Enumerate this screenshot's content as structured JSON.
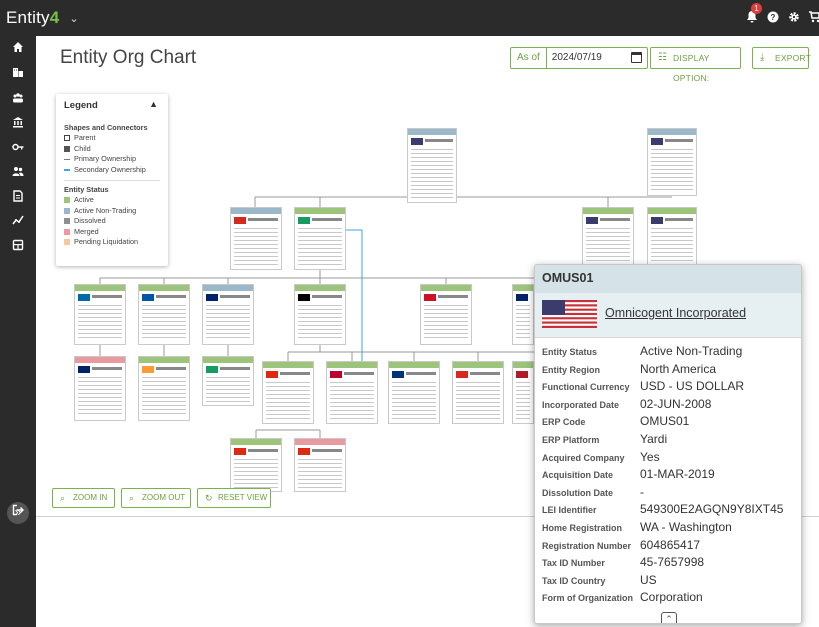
{
  "app": {
    "brand_prefix": "Entity",
    "brand_number": "4",
    "brand_caret": "⌄",
    "notification_count": "1"
  },
  "header": {
    "title": "Entity Org Chart",
    "as_of_label": "As of",
    "as_of_date": "2024/07/19",
    "display_options_label": "DISPLAY OPTION:",
    "export_label": "EXPORT"
  },
  "legend": {
    "title": "Legend",
    "shapes_heading": "Shapes and Connectors",
    "shapes": [
      "Parent",
      "Child",
      "Primary Ownership",
      "Secondary Ownership"
    ],
    "status_heading": "Entity Status",
    "statuses": [
      {
        "label": "Active",
        "color": "#9cc47a"
      },
      {
        "label": "Active Non-Trading",
        "color": "#9ab8c8"
      },
      {
        "label": "Dissolved",
        "color": "#8f8f8f"
      },
      {
        "label": "Merged",
        "color": "#e89aa0"
      },
      {
        "label": "Pending Liquidation",
        "color": "#f5c9a0"
      }
    ]
  },
  "zoom": {
    "zoom_in": "ZOOM IN",
    "zoom_out": "ZOOM OUT",
    "reset": "RESET VIEW"
  },
  "popup": {
    "code": "OMUS01",
    "name": "Omnicogent Incorporated",
    "fields": [
      {
        "key": "Entity Status",
        "value": "Active Non-Trading"
      },
      {
        "key": "Entity Region",
        "value": "North America"
      },
      {
        "key": "Functional Currency",
        "value": "USD - US DOLLAR"
      },
      {
        "key": "Incorporated Date",
        "value": "02-JUN-2008"
      },
      {
        "key": "ERP Code",
        "value": "OMUS01"
      },
      {
        "key": "ERP Platform",
        "value": "Yardi"
      },
      {
        "key": "Acquired Company",
        "value": "Yes"
      },
      {
        "key": "Acquisition Date",
        "value": "01-MAR-2019"
      },
      {
        "key": "Dissolution Date",
        "value": "-"
      },
      {
        "key": "LEI Identifier",
        "value": "549300E2AGQN9Y8IXT45"
      },
      {
        "key": "Home Registration",
        "value": "WA - Washington"
      },
      {
        "key": "Registration Number",
        "value": "604865417"
      },
      {
        "key": "Tax ID Number",
        "value": "45-7657998"
      },
      {
        "key": "Tax ID Country",
        "value": "US"
      },
      {
        "key": "Form of Organization",
        "value": "Corporation"
      }
    ]
  },
  "colors": {
    "accent": "#7bb24b",
    "sidebar": "#2b2b2b",
    "popup_header": "#d5e3e8"
  }
}
